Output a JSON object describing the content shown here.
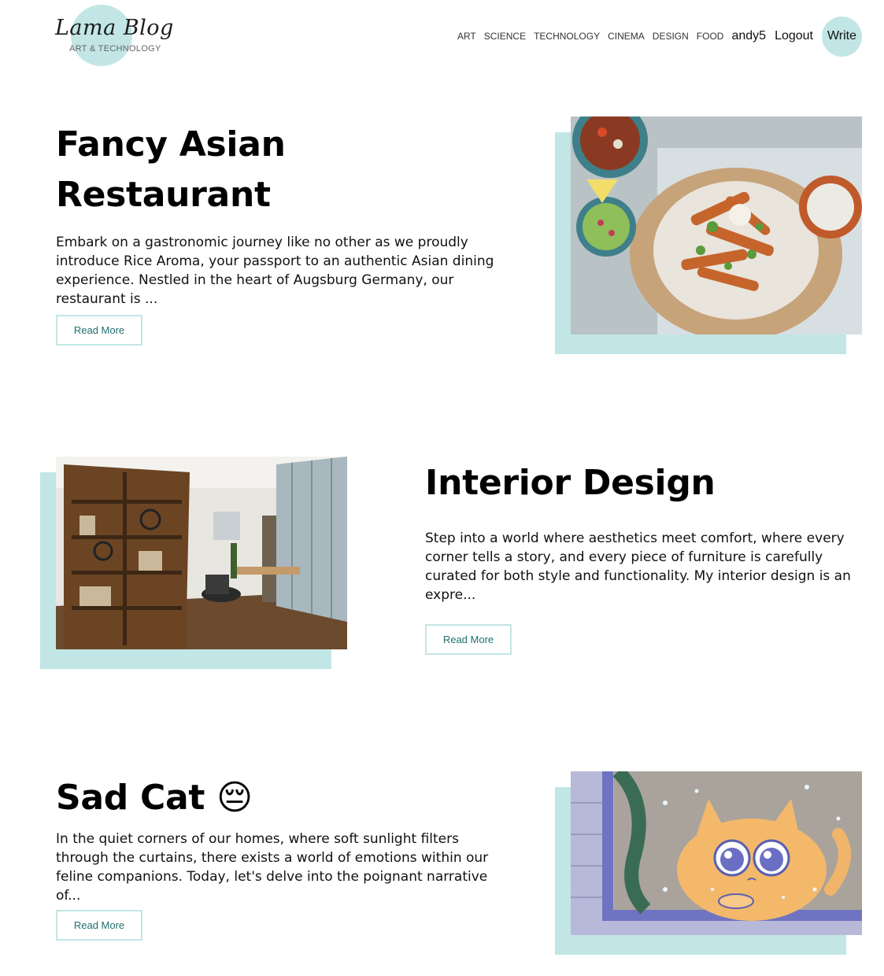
{
  "logo": {
    "title": "Lama Blog",
    "subtitle": "ART & TECHNOLOGY"
  },
  "nav": {
    "categories": [
      "ART",
      "SCIENCE",
      "TECHNOLOGY",
      "CINEMA",
      "DESIGN",
      "FOOD"
    ],
    "username": "andy5",
    "logout_label": "Logout",
    "write_label": "Write"
  },
  "posts": [
    {
      "title": "Fancy Asian Restaurant",
      "description": "Embark on a gastronomic journey like no other as we proudly introduce Rice Aroma, your passport to an authentic Asian dining experience. Nestled in the heart of Augsburg Germany, our restaurant is ...",
      "button_label": "Read More",
      "image": "food-platter-photo"
    },
    {
      "title": "Interior Design",
      "description": "Step into a world where aesthetics meet comfort, where every corner tells a story, and every piece of furniture is carefully curated for both style and functionality. My interior design is an expre...",
      "button_label": "Read More",
      "image": "office-interior-photo"
    },
    {
      "title": "Sad Cat 😔",
      "description": "In the quiet corners of our homes, where soft sunlight filters through the curtains, there exists a world of emotions within our feline companions. Today, let's delve into the poignant narrative of...",
      "button_label": "Read More",
      "image": "sad-cat-illustration"
    }
  ],
  "colors": {
    "accent": "#c2e6e6",
    "button_text": "#1f6f6f",
    "text": "#111111"
  }
}
